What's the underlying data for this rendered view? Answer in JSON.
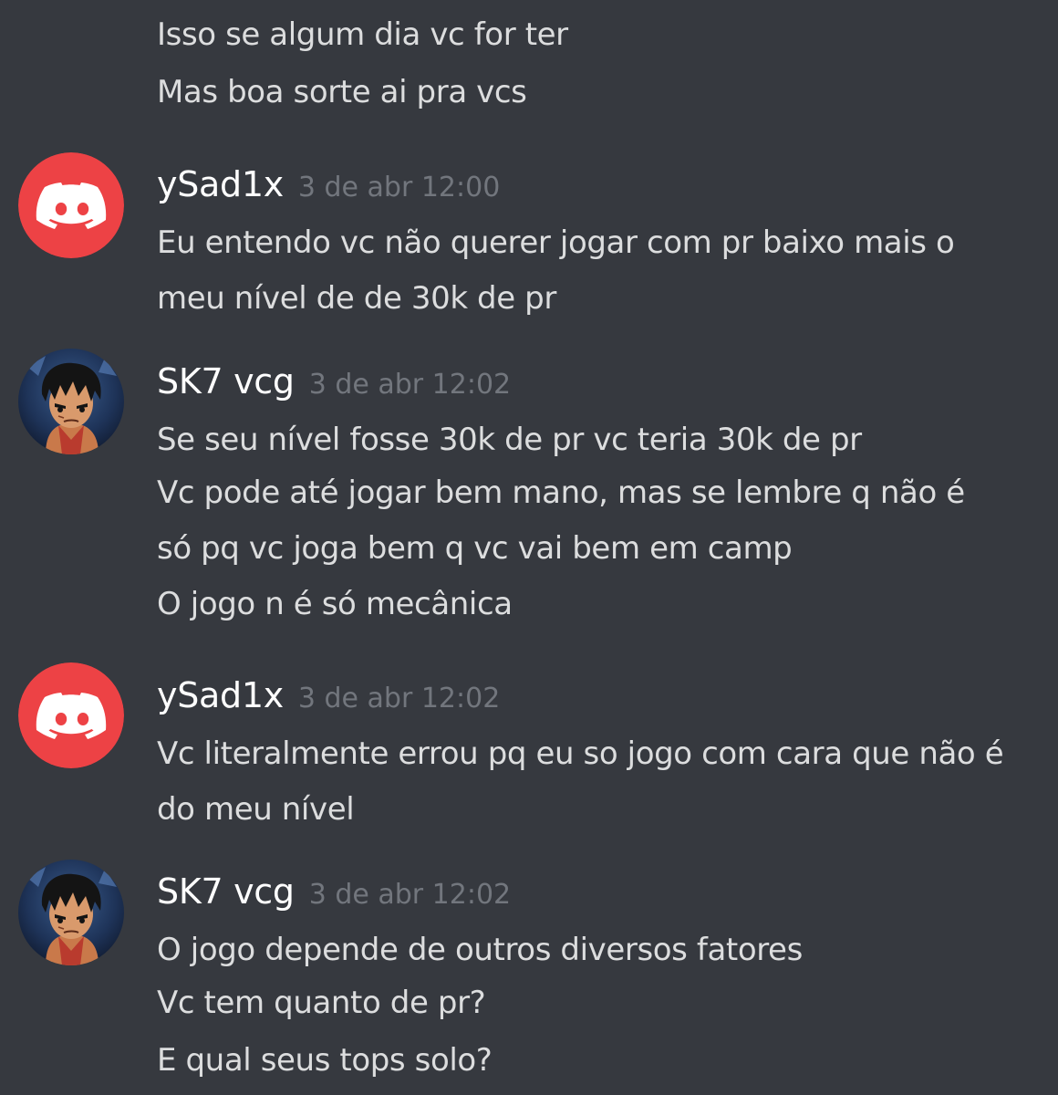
{
  "colors": {
    "background": "#36393f",
    "username": "#ffffff",
    "timestamp": "#72767d",
    "text": "#dcddde",
    "discord_avatar_bg": "#ed4245"
  },
  "continuation": {
    "lines": [
      "Isso se algum dia vc for ter",
      "Mas boa sorte ai pra vcs"
    ]
  },
  "messages": [
    {
      "author": "ySad1x",
      "timestamp": "3 de abr 12:00",
      "avatar": "discord-logo-icon",
      "lines": [
        "Eu entendo vc não querer jogar com pr baixo mais o",
        "meu nível de de 30k de pr"
      ]
    },
    {
      "author": "SK7 vcg",
      "timestamp": "3 de abr 12:02",
      "avatar": "anime-character-avatar",
      "lines": [
        "Se seu nível fosse 30k de pr vc teria 30k de pr",
        "Vc pode até jogar bem mano, mas se lembre q não é",
        "só pq vc joga bem q vc vai bem em camp",
        "O jogo n é só mecânica"
      ]
    },
    {
      "author": "ySad1x",
      "timestamp": "3 de abr 12:02",
      "avatar": "discord-logo-icon",
      "lines": [
        "Vc literalmente errou pq eu so jogo com cara que não é",
        "do meu nível"
      ]
    },
    {
      "author": "SK7 vcg",
      "timestamp": "3 de abr 12:02",
      "avatar": "anime-character-avatar",
      "lines": [
        "O jogo depende de outros diversos fatores",
        "Vc tem quanto de pr?",
        "E qual seus tops solo?"
      ]
    }
  ]
}
